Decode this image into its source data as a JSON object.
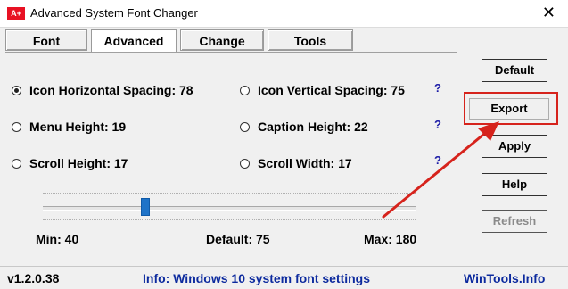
{
  "window": {
    "title": "Advanced System Font Changer",
    "icon_text": "A+",
    "close_glyph": "✕"
  },
  "tabs": [
    {
      "label": "Font"
    },
    {
      "label": "Advanced",
      "active": true
    },
    {
      "label": "Change"
    },
    {
      "label": "Tools"
    }
  ],
  "options": [
    {
      "label": "Icon Horizontal Spacing: 78",
      "selected": true
    },
    {
      "label": "Icon Vertical Spacing: 75",
      "selected": false
    },
    {
      "label": "Menu Height: 19",
      "selected": false
    },
    {
      "label": "Caption Height: 22",
      "selected": false
    },
    {
      "label": "Scroll Height: 17",
      "selected": false
    },
    {
      "label": "Scroll Width: 17",
      "selected": false
    }
  ],
  "help_glyph": "?",
  "slider": {
    "min_label": "Min: 40",
    "default_label": "Default: 75",
    "max_label": "Max: 180",
    "min": 40,
    "max": 180,
    "value": 78
  },
  "buttons": {
    "default": "Default",
    "export": "Export",
    "apply": "Apply",
    "help": "Help",
    "refresh": "Refresh"
  },
  "status": {
    "version": "v1.2.0.38",
    "info": "Info: Windows 10 system font settings",
    "site": "WinTools.Info"
  },
  "colors": {
    "highlight": "#d6231c",
    "thumb": "#1e73c8",
    "info_text": "#0c2a9e"
  }
}
